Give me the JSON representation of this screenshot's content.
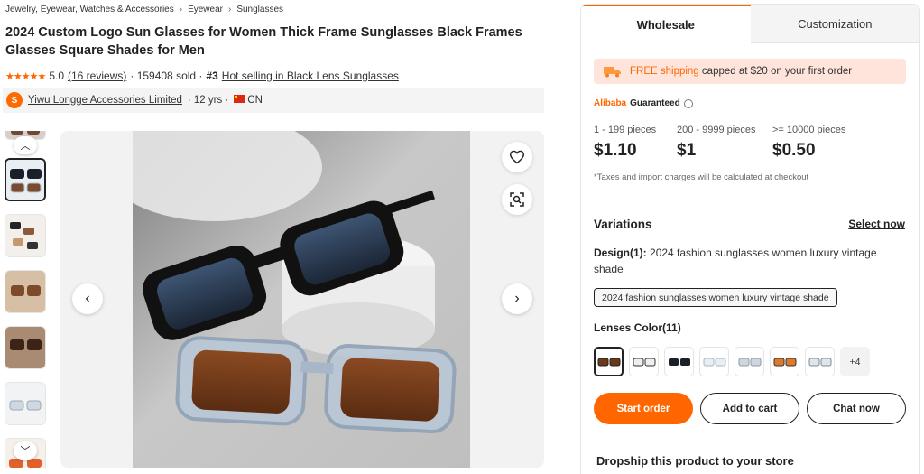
{
  "breadcrumb": [
    "Jewelry, Eyewear, Watches & Accessories",
    "Eyewear",
    "Sunglasses"
  ],
  "product": {
    "title": "2024 Custom Logo Sun Glasses for Women Thick Frame Sunglasses Black Frames Glasses Square Shades for Men",
    "rating": "5.0",
    "reviews": "(16 reviews)",
    "sold": "· 159408 sold ·",
    "rank": "#3",
    "hot_selling": "Hot selling in Black Lens Sunglasses"
  },
  "supplier": {
    "name": "Yiwu Longge Accessories Limited",
    "years": "· 12 yrs ·",
    "country": "CN"
  },
  "tabs": [
    "Wholesale",
    "Customization"
  ],
  "shipping": {
    "highlight": "FREE shipping",
    "text": "capped at $20 on your first order"
  },
  "guarantee": {
    "brand": "Alibaba",
    "label": "Guaranteed"
  },
  "price_tiers": [
    {
      "qty": "1 - 199 pieces",
      "price": "$1.10"
    },
    {
      "qty": "200 - 9999 pieces",
      "price": "$1"
    },
    {
      "qty": ">= 10000 pieces",
      "price": "$0.50"
    }
  ],
  "tax_note": "*Taxes and import charges will be calculated at checkout",
  "variations": {
    "heading": "Variations",
    "select_now": "Select now",
    "design_label": "Design(1):",
    "design_value": "2024 fashion sunglasses women luxury vintage shade",
    "design_chip": "2024 fashion sunglasses women luxury vintage shade",
    "lenses_label": "Lenses Color(11)",
    "more_count": "+4"
  },
  "actions": {
    "start_order": "Start order",
    "add_to_cart": "Add to cart",
    "chat_now": "Chat now"
  },
  "dropship": "Dropship this product to your store",
  "colors": {
    "accent": "#ff6600",
    "shipping_bg": "#ffe4dc"
  }
}
